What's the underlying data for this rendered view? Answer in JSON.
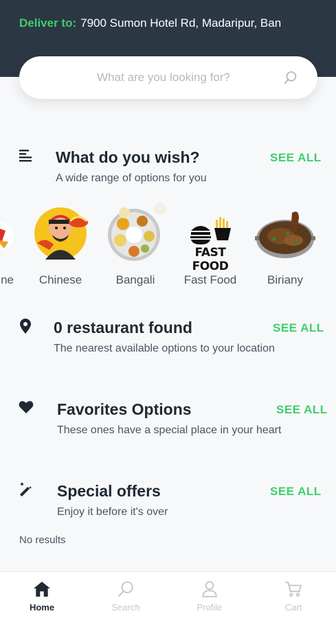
{
  "header": {
    "deliver_label": "Deliver to:",
    "address": "7900 Sumon Hotel Rd, Madaripur, Ban"
  },
  "search": {
    "placeholder": "What are you looking for?",
    "icon": "search-icon"
  },
  "sections": {
    "wish": {
      "icon": "list-icon",
      "title": "What do you wish?",
      "subtitle": "A wide range of options for you",
      "see_all": "SEE ALL"
    },
    "restaurants": {
      "icon": "location-pin-icon",
      "title": "0 restaurant found",
      "subtitle": "The nearest available options to your location",
      "see_all": "SEE ALL"
    },
    "favorites": {
      "icon": "heart-icon",
      "title": "Favorites Options",
      "subtitle": "These ones have a special place in your heart",
      "see_all": "SEE ALL"
    },
    "offers": {
      "icon": "magic-wand-icon",
      "title": "Special offers",
      "subtitle": "Enjoy it before it's over",
      "see_all": "SEE ALL",
      "empty_text": "No results"
    }
  },
  "categories": [
    {
      "label": "ne"
    },
    {
      "label": "Chinese"
    },
    {
      "label": "Bangali"
    },
    {
      "label": "Fast Food",
      "logo_text": "FAST FOOD"
    },
    {
      "label": "Biriany"
    }
  ],
  "tabbar": [
    {
      "label": "Home",
      "icon": "home-icon",
      "active": true
    },
    {
      "label": "Search",
      "icon": "search-icon",
      "active": false
    },
    {
      "label": "Profile",
      "icon": "profile-icon",
      "active": false
    },
    {
      "label": "Cart",
      "icon": "cart-icon",
      "active": false
    }
  ],
  "colors": {
    "header_bg": "#2c3744",
    "accent_green": "#3ecf6a",
    "text_dark": "#1f2933"
  }
}
